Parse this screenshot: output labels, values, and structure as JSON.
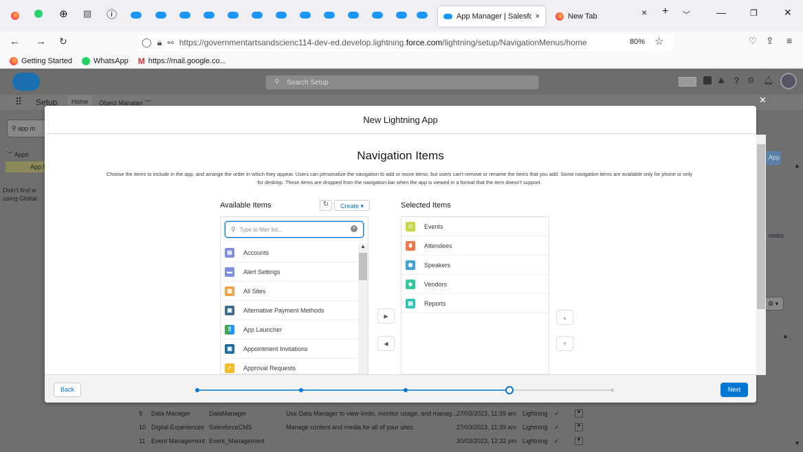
{
  "browser": {
    "tabs": [
      {
        "label": "App Manager | Salesforc",
        "close": "×"
      },
      {
        "label": "New Tab",
        "close": "×"
      }
    ],
    "new_tab": "+",
    "url_prefix": "https://governmentartsandscienc114-dev-ed.develop.lightning.",
    "url_domain": "force.com",
    "url_path": "/lightning/setup/NavigationMenus/home",
    "zoom": "80%",
    "bookmarks": [
      "Getting Started",
      "WhatsApp",
      "https://mail.google.co..."
    ]
  },
  "sf": {
    "search_placeholder": "Search Setup",
    "setup_label": "Setup",
    "nav_tabs": [
      "Home",
      "Object Manager"
    ],
    "quickfind_value": "app m",
    "tree_section": "Apps",
    "tree_item": "App N",
    "not_found_text": [
      "Didn't find w",
      "using Global"
    ],
    "rows": [
      {
        "num": "9",
        "label": "Data Manager",
        "dev": "DataManager",
        "desc": "Use Data Manager to view limits, monitor usage, and manag...",
        "date": "27/03/2023, 11:39 am",
        "type": "Lightning"
      },
      {
        "num": "10",
        "label": "Digital Experiences",
        "dev": "SalesforceCMS",
        "desc": "Manage content and media for all of your sites.",
        "date": "27/03/2023, 11:39 am",
        "type": "Lightning"
      },
      {
        "num": "11",
        "label": "Event Management",
        "dev": "Event_Management",
        "desc": "",
        "date": "30/03/2023, 12:32 pm",
        "type": "Lightning"
      }
    ],
    "right_partial": [
      "App",
      "notes"
    ]
  },
  "modal": {
    "title": "New Lightning App",
    "heading": "Navigation Items",
    "description_line1": "Choose the items to include in the app, and arrange the order in which they appear. Users can personalize the navigation to add or move items, but users can't remove or rename the items that you add. Some navigation items are available only for phone or only",
    "description_line2": "for desktop. These items are dropped from the navigation bar when the app is viewed in a format that the item doesn't support.",
    "available_label": "Available Items",
    "create_label": "Create",
    "filter_placeholder": "Type to filter list...",
    "available_items": [
      {
        "label": "Accounts",
        "color": "#7f8de1"
      },
      {
        "label": "Alert Settings",
        "color": "#7f8de1"
      },
      {
        "label": "All Sites",
        "color": "#f8a046"
      },
      {
        "label": "Alternative Payment Methods",
        "color": "#3b6a8a"
      },
      {
        "label": "App Launcher",
        "color": "#3ba755"
      },
      {
        "label": "Appointment Invitations",
        "color": "#1a6ca6"
      },
      {
        "label": "Approval Requests",
        "color": "#f4bc25"
      }
    ],
    "selected_label": "Selected Items",
    "selected_items": [
      {
        "label": "Events",
        "color": "#c8d649"
      },
      {
        "label": "Attendees",
        "color": "#f0774a"
      },
      {
        "label": "Speakers",
        "color": "#44a3d1"
      },
      {
        "label": "Vendors",
        "color": "#35c79e"
      },
      {
        "label": "Reports",
        "color": "#2dc4b5"
      }
    ],
    "back_label": "Back",
    "next_label": "Next",
    "progress": {
      "steps": 5,
      "current": 4
    }
  },
  "colors": {
    "brand": "#0176d3",
    "progress": "#0176d3"
  }
}
